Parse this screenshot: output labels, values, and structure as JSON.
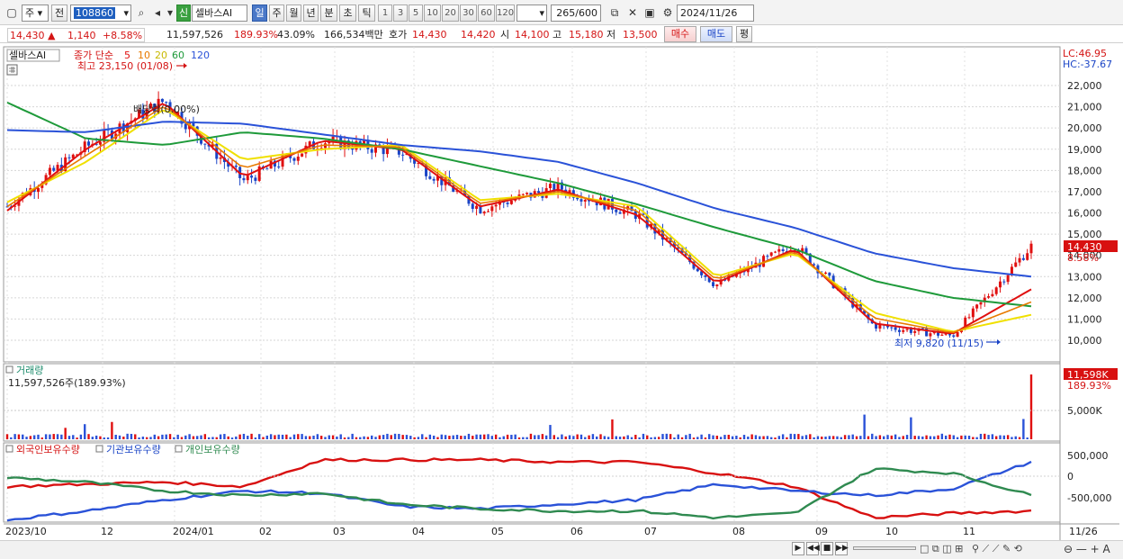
{
  "toolbar": {
    "period_unit": "주",
    "prev_label": "전",
    "code": "108860",
    "stock_badge": "신",
    "stock_name": "셀바스AI",
    "period_tabs": [
      "일",
      "주",
      "월",
      "년",
      "분",
      "초",
      "틱"
    ],
    "active_period": "일",
    "interval_tabs": [
      "1",
      "3",
      "5",
      "10",
      "20",
      "30",
      "60",
      "120"
    ],
    "count_value": "265",
    "count_total": "/600",
    "date_value": "2024/11/26"
  },
  "quote": {
    "price": "14,430",
    "change": "1,140",
    "change_pct": "+8.58%",
    "volume": "11,597,526",
    "volume_ratio": "189.93%",
    "turnover": "43.09%",
    "amount": "166,534백만",
    "ask_label": "호가",
    "ask1": "14,430",
    "ask2": "14,420",
    "open_label": "시",
    "open": "14,100",
    "high_label": "고",
    "high": "15,180",
    "low_label": "저",
    "low": "13,500",
    "buy_label": "매수",
    "sell_label": "매도",
    "eval_label": "평"
  },
  "price_panel": {
    "stock_name": "셀바스AI",
    "ma_title": "종가 단순",
    "ma_periods": [
      "5",
      "10",
      "20",
      "60",
      "120"
    ],
    "ma_colors": [
      "#e01010",
      "#e87a00",
      "#f0e000",
      "#1e9a3a",
      "#2a52d8"
    ],
    "high_marker": "최고 23,150 (01/08)",
    "low_marker": "최저 9,820 (11/15)",
    "dividend_marker": "배당락(0.00%)",
    "lc": "LC:46.95",
    "hc": "HC:-37.67",
    "last_price_tag": "14,430",
    "last_pct_tag": "8.58%",
    "y_labels": [
      "22,000",
      "21,000",
      "20,000",
      "19,000",
      "18,000",
      "17,000",
      "16,000",
      "15,000",
      "14,000",
      "13,000",
      "12,000",
      "11,000",
      "10,000"
    ]
  },
  "volume_panel": {
    "title": "거래량",
    "value": "11,597,526주(189.93%)",
    "last_tag": "11,598K",
    "last_pct": "189.93%",
    "y_label": "5,000K"
  },
  "holdings_panel": {
    "series_names": [
      "외국인보유수량",
      "기관보유수량",
      "개인보유수량"
    ],
    "series_colors": [
      "#d81010",
      "#2a52d8",
      "#2f8a50"
    ],
    "y_labels": [
      "500,000",
      "0",
      "-500,000"
    ]
  },
  "x_axis": {
    "labels": [
      "2023/10",
      "12",
      "2024/01",
      "02",
      "03",
      "04",
      "05",
      "06",
      "07",
      "08",
      "09",
      "10",
      "11"
    ],
    "right_label": "11/26"
  },
  "chart_data": {
    "type": "line",
    "title": "셀바스AI",
    "x": [
      "2023/10",
      "12",
      "2024/01",
      "02",
      "03",
      "04",
      "05",
      "06",
      "07",
      "08",
      "09",
      "10",
      "11",
      "11/26"
    ],
    "ylim": [
      9500,
      22800
    ],
    "series": [
      {
        "name": "종가",
        "values": [
          16300,
          19100,
          21300,
          17500,
          19400,
          18900,
          16200,
          17200,
          15900,
          12600,
          14500,
          10700,
          10200,
          14430
        ]
      },
      {
        "name": "5",
        "values": [
          16100,
          19000,
          21200,
          17700,
          19400,
          19000,
          16300,
          17100,
          15900,
          12700,
          14300,
          10800,
          10300,
          12400
        ]
      },
      {
        "name": "20",
        "values": [
          16500,
          18400,
          20900,
          18500,
          19000,
          19200,
          16600,
          16900,
          16300,
          13000,
          14100,
          11300,
          10400,
          11200
        ]
      },
      {
        "name": "60",
        "values": [
          21200,
          19500,
          19200,
          19800,
          19500,
          19000,
          18200,
          17400,
          16400,
          15300,
          14300,
          12800,
          12000,
          11600
        ]
      },
      {
        "name": "120",
        "values": [
          19900,
          19800,
          20300,
          20200,
          19700,
          19200,
          18900,
          18400,
          17400,
          16200,
          15300,
          14100,
          13400,
          13000
        ]
      }
    ],
    "annotations": [
      "최고 23,150 (01/08)",
      "최저 9,820 (11/15)",
      "배당락(0.00%)"
    ],
    "volume_last": 11597526,
    "holdings_ylim": [
      -900000,
      800000
    ]
  }
}
